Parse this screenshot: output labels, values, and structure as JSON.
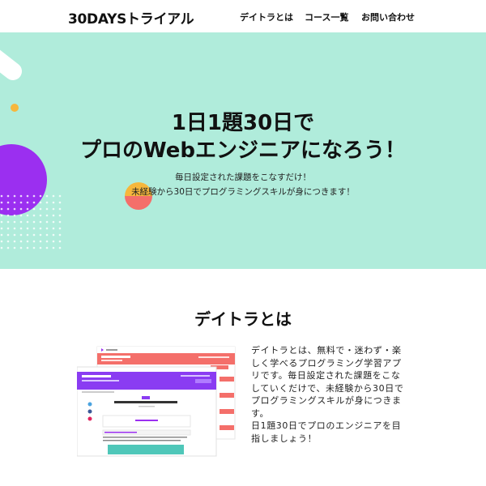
{
  "header": {
    "logo": "30DAYSトライアル",
    "nav": [
      {
        "label": "デイトラとは"
      },
      {
        "label": "コース一覧"
      },
      {
        "label": "お問い合わせ"
      }
    ]
  },
  "hero": {
    "title_line1": "1日1題30日で",
    "title_line2": "プロのWebエンジニアになろう！",
    "sub_line1": "毎日設定された課題をこなすだけ！",
    "sub_line2": "未経験から30日でプログラミングスキルが身につきます！"
  },
  "about": {
    "title": "デイトラとは",
    "text_lines": [
      "デイトラとは、無料で・迷わず・楽",
      "しく学べるプログラミング学習アプ",
      "リです。毎日設定された課題をこな",
      "していくだけで、未経験から30日で",
      "プログラミングスキルが身につきま",
      "す。",
      "日1題30日でプロのエンジニアを目",
      "指しましょう！"
    ]
  },
  "colors": {
    "hero_bg": "#b0ecdb",
    "accent_purple": "#9b2ff0",
    "accent_coral": "#f46f6a",
    "accent_yellow": "#f6b73c"
  }
}
